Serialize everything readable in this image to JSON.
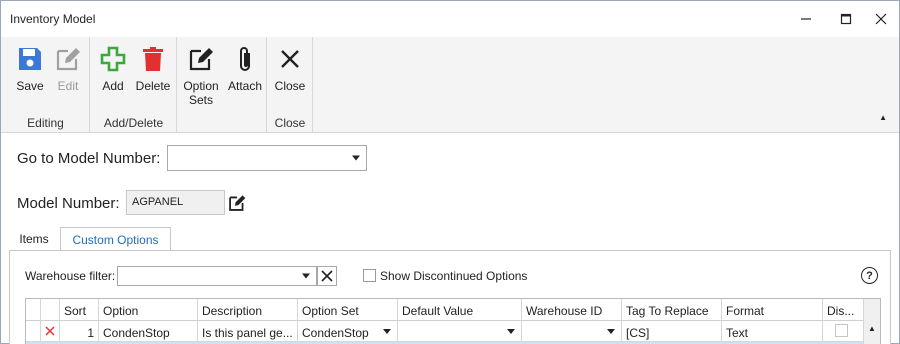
{
  "window": {
    "title": "Inventory Model",
    "minimize_icon": "minimize-icon",
    "maximize_icon": "maximize-icon",
    "close_icon": "close-icon"
  },
  "ribbon": {
    "groups": [
      {
        "label": "Editing",
        "buttons": [
          {
            "label": "Save",
            "icon": "save-icon",
            "color": "#3b78d8"
          },
          {
            "label": "Edit",
            "icon": "edit-icon",
            "color": "#a0a0a0",
            "disabled": true
          }
        ]
      },
      {
        "label": "Add/Delete",
        "buttons": [
          {
            "label": "Add",
            "icon": "add-icon",
            "color": "#3aa83a"
          },
          {
            "label": "Delete",
            "icon": "delete-icon",
            "color": "#e03030"
          }
        ]
      },
      {
        "label": "",
        "buttons": [
          {
            "label": "Option Sets",
            "label_line1": "Option",
            "label_line2": "Sets",
            "icon": "option-sets-icon"
          },
          {
            "label": "Attach",
            "icon": "paperclip-icon"
          }
        ]
      },
      {
        "label": "Close",
        "buttons": [
          {
            "label": "Close",
            "icon": "close-x-icon"
          }
        ]
      }
    ],
    "collapse_icon": "collapse-ribbon-icon"
  },
  "form": {
    "goto_label": "Go to Model Number:",
    "goto_value": "",
    "model_number_label": "Model Number:",
    "model_number_value": "AGPANEL"
  },
  "tabs": [
    {
      "label": "Items",
      "active": false
    },
    {
      "label": "Custom Options",
      "active": true
    }
  ],
  "custom_options": {
    "warehouse_filter_label": "Warehouse filter:",
    "warehouse_filter_value": "",
    "show_discontinued_label": "Show Discontinued Options",
    "show_discontinued_checked": false,
    "help_icon": "help-icon",
    "grid": {
      "columns": [
        "",
        "Sort",
        "Option",
        "Description",
        "Option Set",
        "Default Value",
        "Warehouse ID",
        "Tag To Replace",
        "Format",
        "Dis..."
      ],
      "rows": [
        {
          "marker": "delete-row-icon",
          "sort": "1",
          "option": "CondenStop",
          "description": "Is this panel ge...",
          "option_set": "CondenStop",
          "default_value": "",
          "warehouse_id": "",
          "tag": "[CS]",
          "format": "Text",
          "discontinued": false
        }
      ]
    }
  },
  "colors": {
    "accent": "#1d6fb8",
    "ribbon_bg": "#f4f4f4",
    "row_selected": "#cfe2f3"
  }
}
